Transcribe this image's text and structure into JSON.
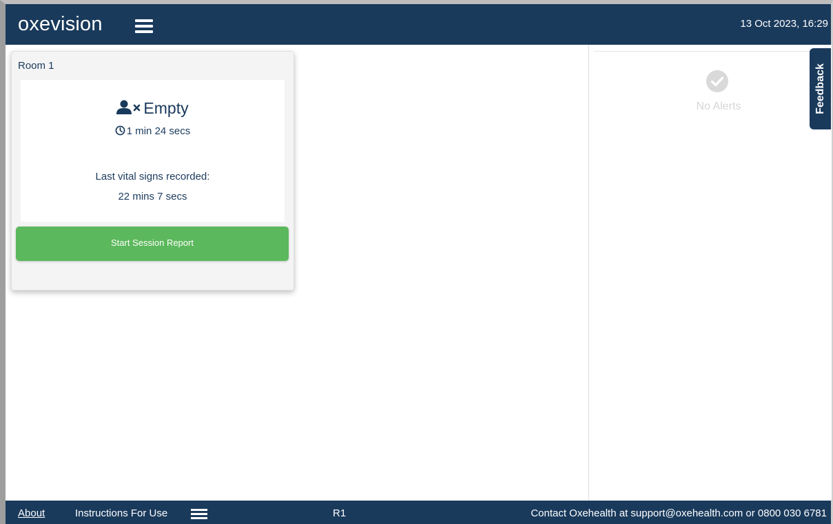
{
  "header": {
    "logo": "oxevision",
    "datetime": "13 Oct 2023, 16:29"
  },
  "room": {
    "name": "Room 1",
    "status": "Empty",
    "elapsed": "1 min 24 secs",
    "vitals_label": "Last vital signs recorded:",
    "vitals_value": "22 mins 7 secs",
    "button_label": "Start Session Report",
    "button_color": "#5cb85c"
  },
  "alerts": {
    "empty_text": "No Alerts"
  },
  "feedback": {
    "label": "Feedback"
  },
  "footer": {
    "about": "About",
    "instructions": "Instructions For Use",
    "room_code": "R1",
    "contact": "Contact Oxehealth at support@oxehealth.com or 0800 030 6781"
  },
  "colors": {
    "brand_navy": "#1a3a5c",
    "success_green": "#5cb85c"
  }
}
